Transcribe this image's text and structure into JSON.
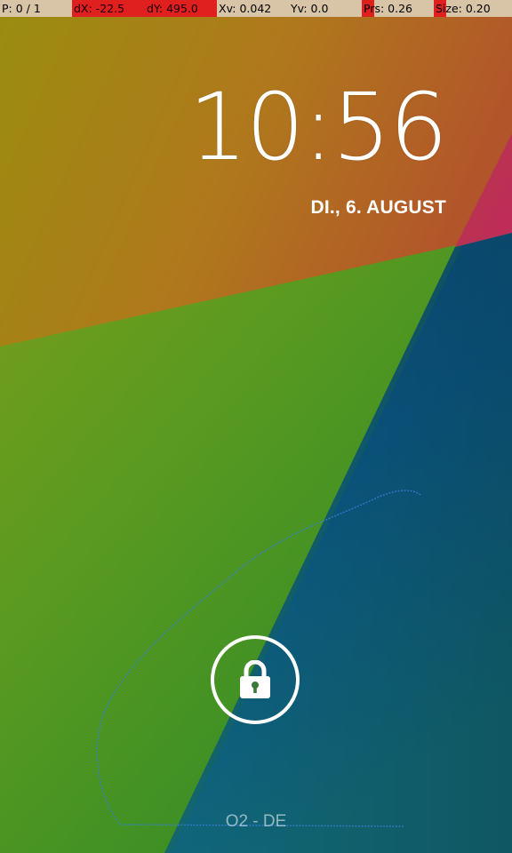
{
  "debug_bar": {
    "pointers": "P: 0 / 1",
    "dx": "dX: -22.5",
    "dy": "dY: 495.0",
    "xv": "Xv: 0.042",
    "yv": "Yv: 0.0",
    "pressure": "Prs: 0.26",
    "size": "Size: 0.20"
  },
  "lockscreen": {
    "time": "10:56",
    "date": "DI., 6. AUGUST",
    "carrier": "O2 - DE",
    "lock_icon": "lock-icon"
  },
  "colors": {
    "debug_beige": "#d8c4a6",
    "debug_red": "#e0201e",
    "trail_blue": "#3a7fd8",
    "text_white": "#ffffff"
  }
}
